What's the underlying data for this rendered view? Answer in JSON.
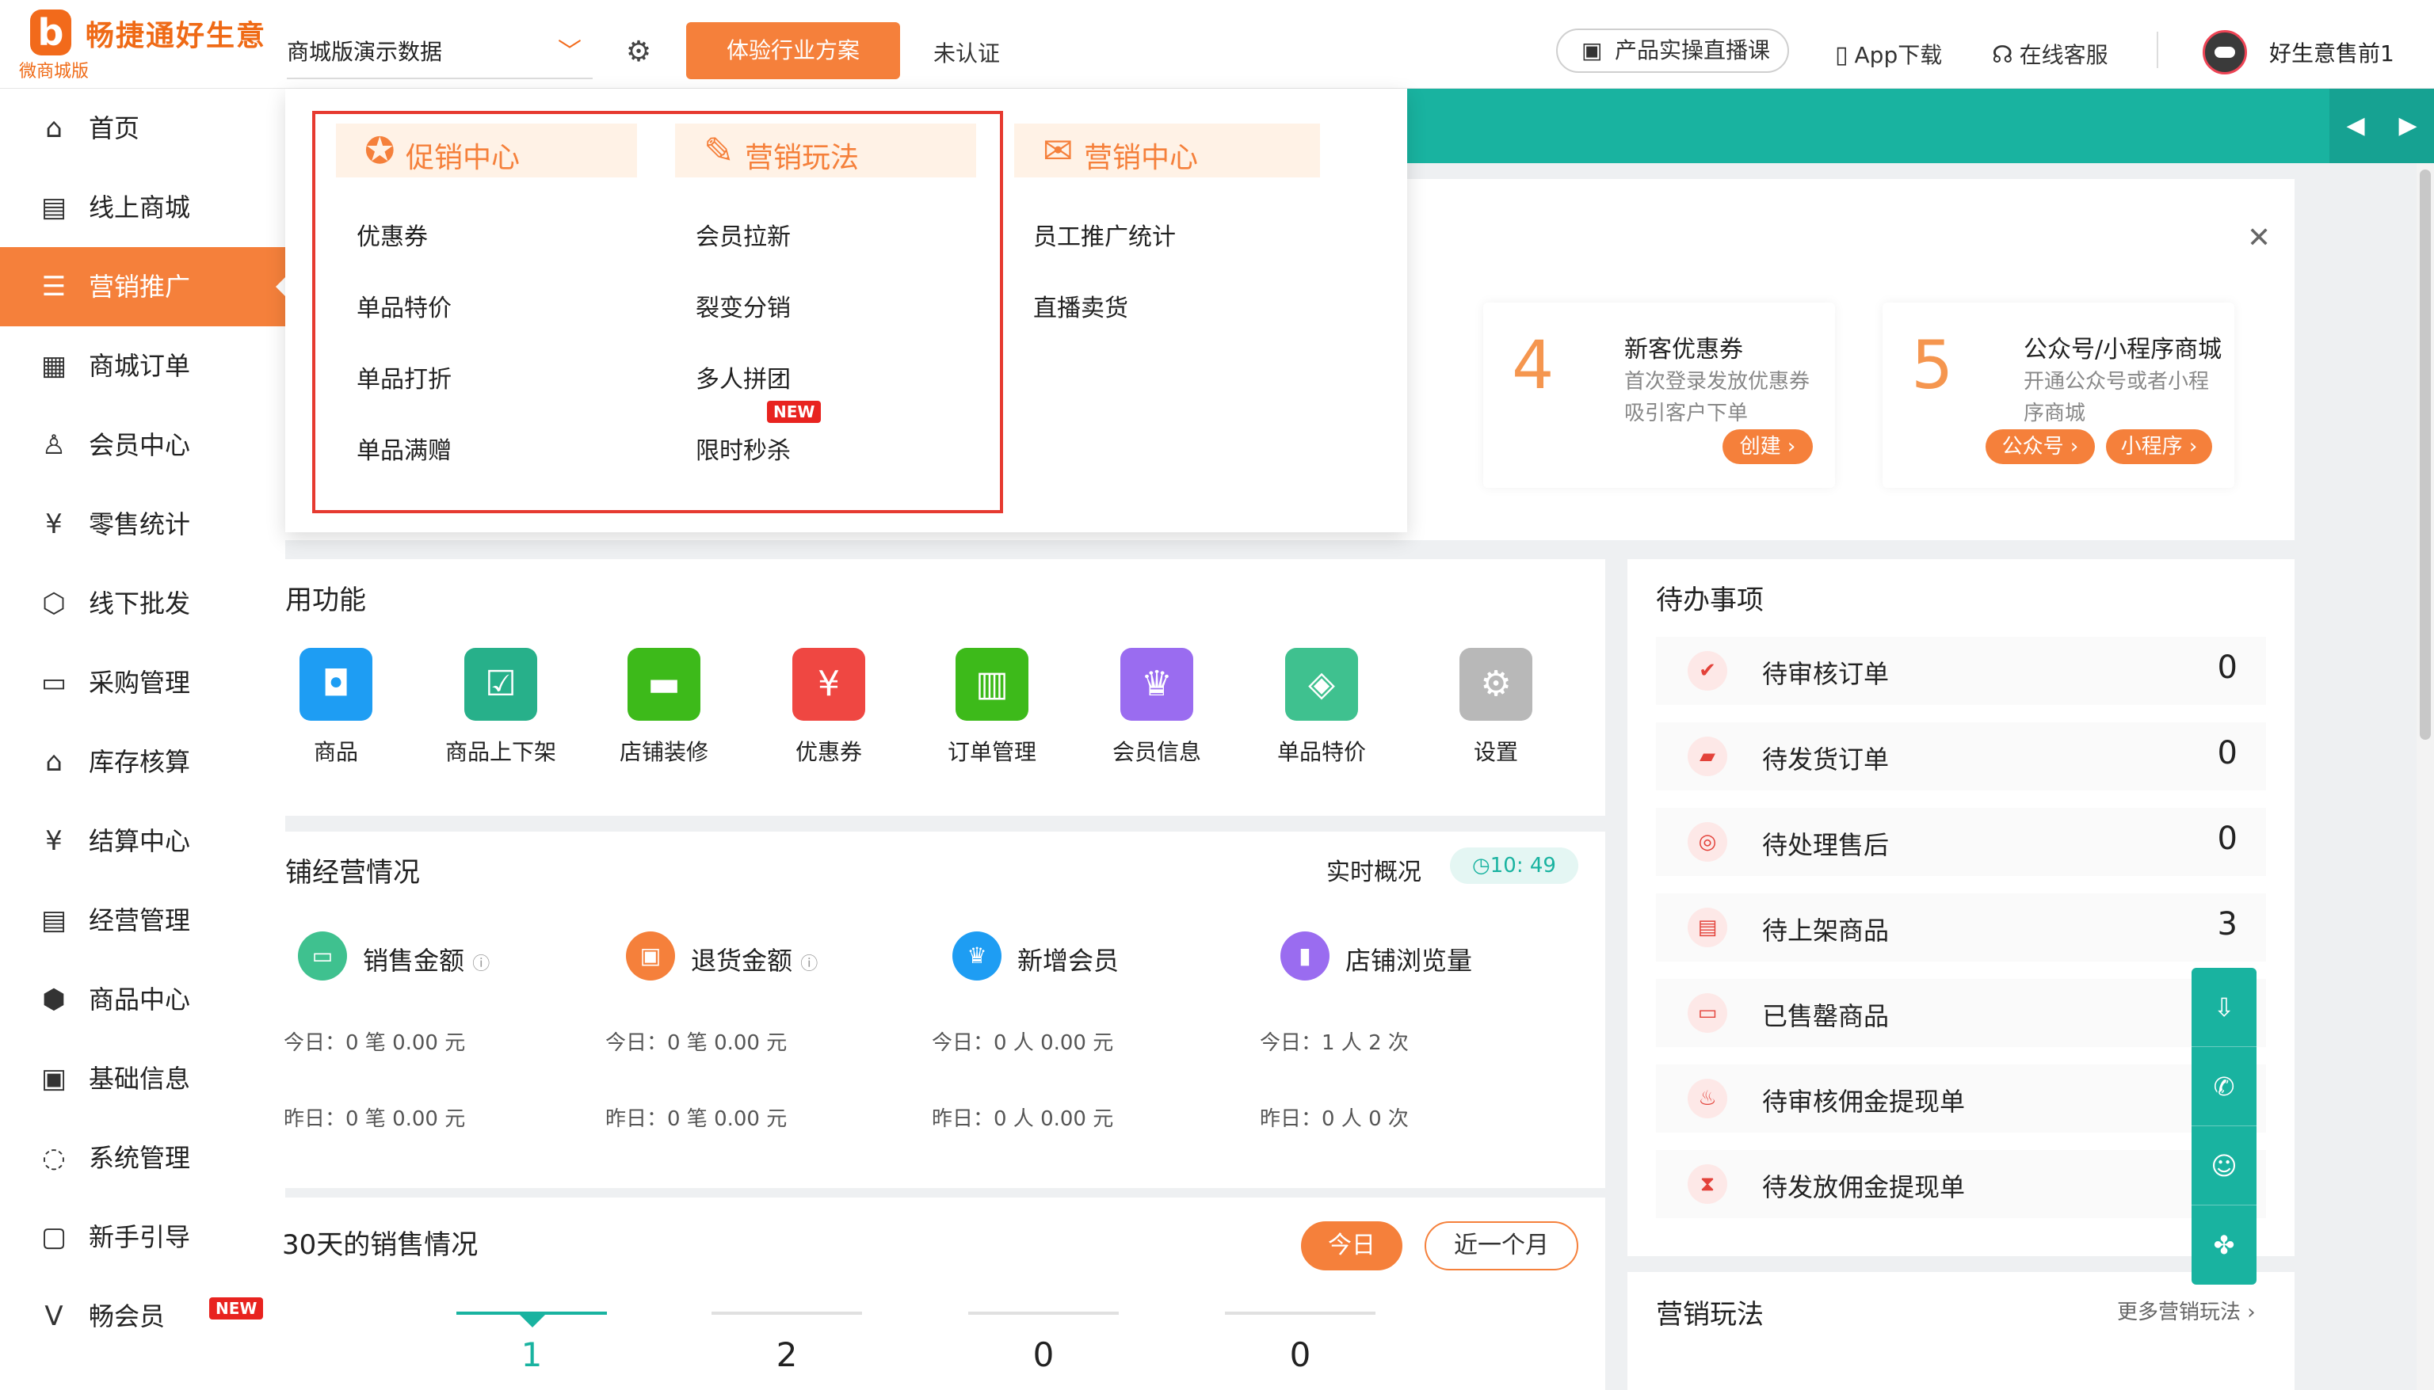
{
  "header": {
    "brand": "畅捷通好生意",
    "brand_sub": "微商城版",
    "logo_letter": "b",
    "store": "商城版演示数据",
    "cta": "体验行业方案",
    "verify": "未认证",
    "live": "产品实操直播课",
    "app": "App下载",
    "service": "在线客服",
    "user": "好生意售前1"
  },
  "sidebar": {
    "items": [
      {
        "label": "首页",
        "icon": "home-icon"
      },
      {
        "label": "线上商城",
        "icon": "shop-icon"
      },
      {
        "label": "营销推广",
        "icon": "marketing-icon",
        "active": true
      },
      {
        "label": "商城订单",
        "icon": "order-icon"
      },
      {
        "label": "会员中心",
        "icon": "member-icon"
      },
      {
        "label": "零售统计",
        "icon": "retail-icon"
      },
      {
        "label": "线下批发",
        "icon": "wholesale-icon"
      },
      {
        "label": "采购管理",
        "icon": "purchase-icon"
      },
      {
        "label": "库存核算",
        "icon": "inventory-icon"
      },
      {
        "label": "结算中心",
        "icon": "settlement-icon"
      },
      {
        "label": "经营管理",
        "icon": "operation-icon"
      },
      {
        "label": "商品中心",
        "icon": "product-icon"
      },
      {
        "label": "基础信息",
        "icon": "info-icon"
      },
      {
        "label": "系统管理",
        "icon": "system-icon"
      },
      {
        "label": "新手引导",
        "icon": "guide-icon"
      },
      {
        "label": "畅会员",
        "icon": "vip-icon"
      }
    ],
    "new_badge": "NEW"
  },
  "mega_menu": {
    "col1": {
      "title": "促销中心",
      "links": [
        "优惠券",
        "单品特价",
        "单品打折",
        "单品满赠"
      ]
    },
    "col2": {
      "title": "营销玩法",
      "links": [
        "会员拉新",
        "裂变分销",
        "多人拼团",
        "限时秒杀"
      ]
    },
    "col3": {
      "title": "营销中心",
      "links": [
        "员工推广统计",
        "直播卖货"
      ]
    },
    "new_badge": "NEW"
  },
  "steps": [
    {
      "num": "4",
      "title": "新客优惠券",
      "desc": "首次登录发放优惠券吸引客户下单",
      "btns": [
        "创建"
      ]
    },
    {
      "num": "5",
      "title": "公众号/小程序商城",
      "desc": "开通公众号或者小程序商城",
      "btns": [
        "公众号",
        "小程序"
      ]
    }
  ],
  "common": {
    "title": "用功能",
    "items": [
      {
        "label": "商品",
        "icon": "bag-icon",
        "color": "#1e9df3"
      },
      {
        "label": "商品上下架",
        "icon": "checklist-icon",
        "color": "#27b08a"
      },
      {
        "label": "店铺装修",
        "icon": "paint-roller-icon",
        "color": "#3dba1a"
      },
      {
        "label": "优惠券",
        "icon": "coupon-icon",
        "color": "#ef4742"
      },
      {
        "label": "订单管理",
        "icon": "orders-icon",
        "color": "#3dba1a"
      },
      {
        "label": "会员信息",
        "icon": "crown-icon",
        "color": "#9a6cf0"
      },
      {
        "label": "单品特价",
        "icon": "tag-icon",
        "color": "#3fc18f"
      },
      {
        "label": "设置",
        "icon": "gear-icon",
        "color": "#b8b8b8"
      }
    ]
  },
  "todo": {
    "title": "待办事项",
    "rows": [
      {
        "label": "待审核订单",
        "count": "0"
      },
      {
        "label": "待发货订单",
        "count": "0"
      },
      {
        "label": "待处理售后",
        "count": "0"
      },
      {
        "label": "待上架商品",
        "count": "3"
      },
      {
        "label": "已售罄商品",
        "count": ""
      },
      {
        "label": "待审核佣金提现单",
        "count": ""
      },
      {
        "label": "待发放佣金提现单",
        "count": ""
      }
    ]
  },
  "ops": {
    "title": "铺经营情况",
    "realtime": "实时概况",
    "time": "10: 49",
    "metrics": [
      {
        "label": "销售金额",
        "today": "今日：0 笔 0.00 元",
        "yesterday": "昨日：0 笔 0.00 元",
        "color": "#3fc18f"
      },
      {
        "label": "退货金额",
        "today": "今日：0 笔 0.00 元",
        "yesterday": "昨日：0 笔 0.00 元",
        "color": "#f5803b"
      },
      {
        "label": "新增会员",
        "today": "今日：0 人 0.00 元",
        "yesterday": "昨日：0 人 0.00 元",
        "color": "#1e9df3"
      },
      {
        "label": "店铺浏览量",
        "today": "今日：1 人 2 次",
        "yesterday": "昨日：0 人 0 次",
        "color": "#9a6cf0"
      }
    ]
  },
  "sales": {
    "title": "30天的销售情况",
    "btn_today": "今日",
    "btn_month": "近一个月",
    "tabs": [
      "1",
      "2",
      "0",
      "0"
    ]
  },
  "marketing": {
    "title": "营销玩法",
    "more": "更多营销玩法"
  },
  "colors": {
    "accent": "#f5803b",
    "teal": "#19b3a0",
    "danger": "#e63a30"
  }
}
